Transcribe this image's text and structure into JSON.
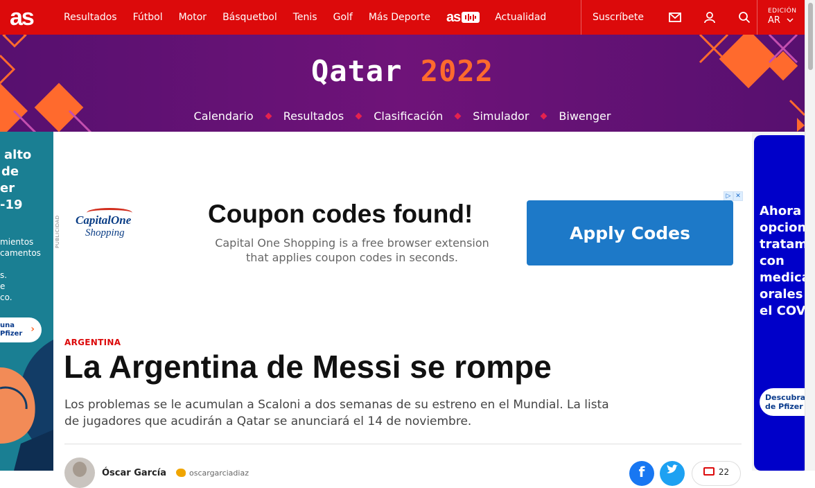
{
  "topbar": {
    "logo": "as",
    "nav": [
      "Resultados",
      "Fútbol",
      "Motor",
      "Básquetbol",
      "Tenis",
      "Golf",
      "Más Deporte"
    ],
    "audio_logo": "as",
    "nav_after": "Actualidad",
    "subscribe": "Suscríbete",
    "edition_label": "EDICIÓN",
    "edition_value": "AR"
  },
  "banner": {
    "title_word": "Qatar",
    "title_year": "2022",
    "nav": [
      "Calendario",
      "Resultados",
      "Clasificación",
      "Simulador",
      "Biwenger"
    ]
  },
  "left_ad": {
    "headline_lines": [
      "alto",
      "de",
      "er",
      "-19"
    ],
    "body_lines": [
      "mientos",
      "camentos"
    ],
    "body2_lines": [
      "s.",
      "e",
      "co."
    ],
    "button_lines": [
      "una",
      "Pfizer"
    ]
  },
  "right_ad": {
    "headline_lines": [
      "Ahora ",
      "opcione",
      "tratami",
      "con",
      "medica",
      "orales ",
      "el COV"
    ],
    "button_lines": [
      "Descubra ",
      "de Pfizer"
    ]
  },
  "coupon_ad": {
    "publicidad_label": "PUBLICIDAD",
    "brand_top": "CapitalOne",
    "brand_sub": "Shopping",
    "headline": "Coupon codes found!",
    "subtext": "Capital One Shopping is a free browser extension that applies coupon codes in seconds.",
    "button": "Apply Codes"
  },
  "article": {
    "section": "ARGENTINA",
    "headline": "La Argentina de Messi se rompe",
    "subtitle": "Los problemas se le acumulan a Scaloni a dos semanas de su estreno en el Mundial. La lista de jugadores que acudirán a Qatar se anunciará el 14 de noviembre.",
    "author": "Óscar García",
    "twitter_handle": "oscargarciadiaz",
    "comments_count": "22"
  },
  "colors": {
    "brand_red": "#dc0a0b",
    "banner_purple": "#6f1379",
    "qatar_orange": "#ff6a2d",
    "pfizer_blue": "#0000c9"
  }
}
